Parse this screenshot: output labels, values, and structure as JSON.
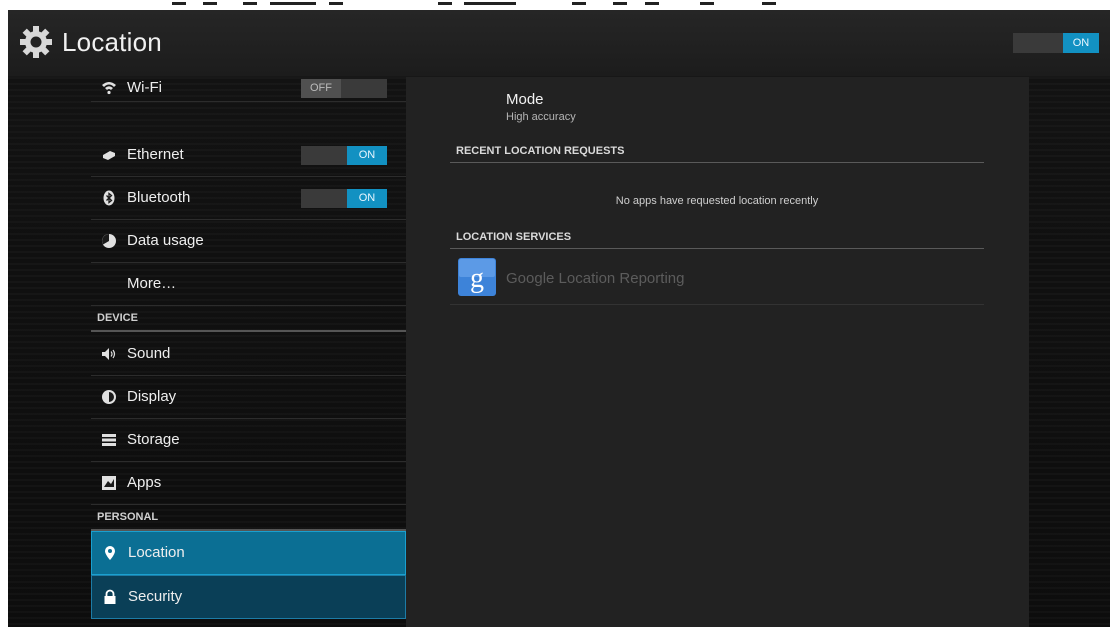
{
  "action_bar": {
    "title": "Location",
    "master_toggle": "ON"
  },
  "left_list": {
    "wifi": {
      "label": "Wi-Fi",
      "toggle": "OFF"
    },
    "ethernet": {
      "label": "Ethernet",
      "toggle": "ON"
    },
    "bluetooth": {
      "label": "Bluetooth",
      "toggle": "ON"
    },
    "data_usage": {
      "label": "Data usage"
    },
    "more": {
      "label": "More…"
    },
    "device_header": "DEVICE",
    "sound": {
      "label": "Sound"
    },
    "display": {
      "label": "Display"
    },
    "storage": {
      "label": "Storage"
    },
    "apps": {
      "label": "Apps"
    },
    "personal_header": "PERSONAL",
    "location": {
      "label": "Location"
    },
    "security": {
      "label": "Security"
    }
  },
  "detail": {
    "mode_title": "Mode",
    "mode_value": "High accuracy",
    "recent_header": "RECENT LOCATION REQUESTS",
    "recent_empty": "No apps have requested location recently",
    "services_header": "LOCATION SERVICES",
    "service_google": "Google Location Reporting"
  },
  "colors": {
    "accent": "#1291c2",
    "selected_row": "#0b6f94",
    "focused_row": "#0a3f57",
    "background": "#0d0d0d",
    "pane": "#222222"
  },
  "icons": {
    "app": "gear-icon",
    "wifi": "wifi-icon",
    "ethernet": "ethernet-icon",
    "bluetooth": "bluetooth-icon",
    "data_usage": "data-usage-icon",
    "sound": "speaker-icon",
    "display": "brightness-icon",
    "storage": "storage-icon",
    "apps": "apps-icon",
    "location": "location-pin-icon",
    "security": "lock-icon",
    "google": "google-icon"
  }
}
